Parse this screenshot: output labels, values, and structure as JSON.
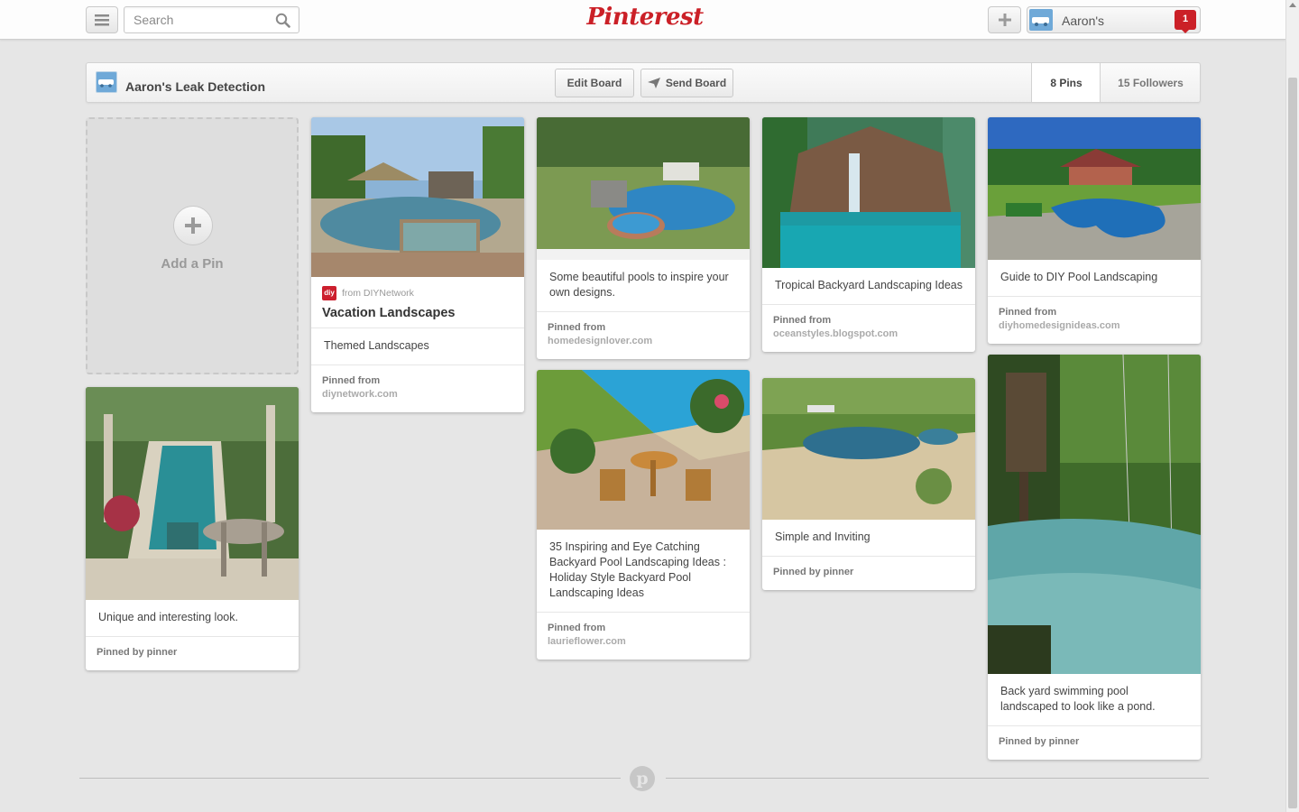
{
  "header": {
    "search_placeholder": "Search",
    "logo_text": "Pinterest",
    "user_name": "Aaron's",
    "notification_count": "1"
  },
  "board": {
    "title": "Aaron's Leak Detection",
    "edit_label": "Edit Board",
    "send_label": "Send Board",
    "pins_label": "8 Pins",
    "followers_label": "15 Followers"
  },
  "add_pin": {
    "label": "Add a Pin"
  },
  "pins": [
    {
      "from": "from DIYNetwork",
      "title": "Vacation Landscapes",
      "desc": "Themed Landscapes",
      "credit_prefix": "Pinned from",
      "credit_source": "diynetwork.com"
    },
    {
      "desc": "Unique and interesting look.",
      "credit_prefix": "Pinned by",
      "credit_source": "pinner"
    },
    {
      "desc": "Some beautiful pools to inspire your own designs.",
      "credit_prefix": "Pinned from",
      "credit_source": "homedesignlover.com"
    },
    {
      "desc": "35 Inspiring and Eye Catching Backyard Pool Landscaping Ideas : Holiday Style Backyard Pool Landscaping Ideas",
      "credit_prefix": "Pinned from",
      "credit_source": "laurieflower.com"
    },
    {
      "desc": "Tropical Backyard Landscaping Ideas",
      "credit_prefix": "Pinned from",
      "credit_source": "oceanstyles.blogspot.com"
    },
    {
      "desc": "Simple and Inviting",
      "credit_prefix": "Pinned by",
      "credit_source": "pinner"
    },
    {
      "desc": "Guide to DIY Pool Landscaping",
      "credit_prefix": "Pinned from",
      "credit_source": "diyhomedesignideas.com"
    },
    {
      "desc": "Back yard swimming pool landscaped to look like a pond.",
      "credit_prefix": "Pinned by",
      "credit_source": "pinner"
    }
  ],
  "colors": {
    "brand_red": "#cb2027",
    "background": "#e6e6e6"
  }
}
